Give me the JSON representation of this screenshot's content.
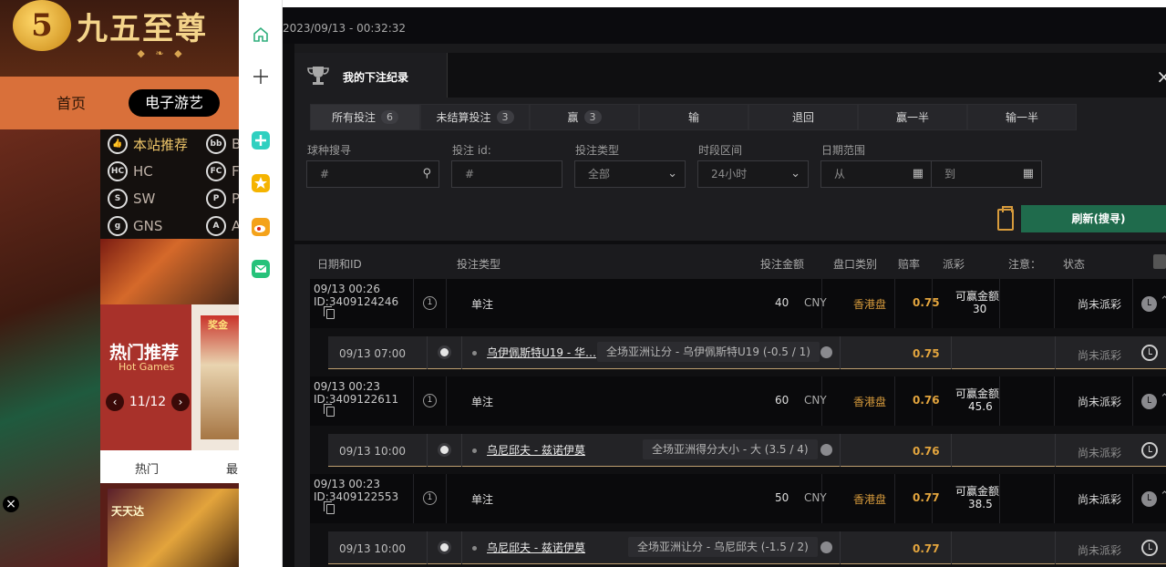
{
  "site": {
    "logo_glyph": "5",
    "logo_text": "九五至尊",
    "nav": [
      "首页",
      "电子游艺"
    ],
    "providers": [
      "本站推荐",
      "B",
      "HC",
      "F",
      "SW",
      "P",
      "GNS",
      "A"
    ],
    "hot_title": "热门推荐",
    "hot_subtitle": "Hot Games",
    "pager_label": "11/12",
    "card_tag": "奖金",
    "tabs": [
      "热门",
      "最"
    ],
    "banner2_text": "天天达"
  },
  "toolbar": {
    "items": [
      "home-icon",
      "plus-icon",
      "pin-icon",
      "star-icon",
      "weibo-icon",
      "mail-icon"
    ]
  },
  "panel": {
    "datetime": "2023/09/13 - 00:32:32"
  },
  "modal": {
    "title": "我的下注纪录",
    "tabs": [
      {
        "label": "所有投注",
        "count": "6"
      },
      {
        "label": "未结算投注",
        "count": "3"
      },
      {
        "label": "赢",
        "count": "3"
      },
      {
        "label": "输",
        "count": ""
      },
      {
        "label": "退回",
        "count": ""
      },
      {
        "label": "赢一半",
        "count": ""
      },
      {
        "label": "输一半",
        "count": ""
      }
    ],
    "filters": {
      "sport_label": "球种搜寻",
      "sport_placeholder": "#",
      "betid_label": "投注 id:",
      "betid_placeholder": "#",
      "type_label": "投注类型",
      "type_value": "全部",
      "period_label": "时段区间",
      "period_value": "24小时",
      "date_label": "日期范围",
      "date_from": "从",
      "date_to": "到"
    },
    "refresh_label": "刷新(搜寻)"
  },
  "table": {
    "headers": [
      "日期和ID",
      "投注类型",
      "投注金额",
      "盘口类别",
      "赔率",
      "派彩",
      "注意：",
      "状态"
    ],
    "rows": [
      {
        "date": "09/13 00:26",
        "id": "ID:3409124246",
        "kind": "单注",
        "amount": "40",
        "currency": "CNY",
        "market": "香港盘",
        "odds": "0.75",
        "win_label": "可赢金额",
        "win_amount": "30",
        "status": "尚未派彩",
        "sub": {
          "date": "09/13 07:00",
          "match": "乌伊佩斯特U19 - 华…",
          "bet": "全场亚洲让分 - 乌伊佩斯特U19 (-0.5 / 1)",
          "odds": "0.75",
          "status": "尚未派彩"
        }
      },
      {
        "date": "09/13 00:23",
        "id": "ID:3409122611",
        "kind": "单注",
        "amount": "60",
        "currency": "CNY",
        "market": "香港盘",
        "odds": "0.76",
        "win_label": "可赢金额",
        "win_amount": "45.6",
        "status": "尚未派彩",
        "sub": {
          "date": "09/13 10:00",
          "match": "乌尼邱夫 - 兹诺伊莫",
          "bet": "全场亚洲得分大小 - 大 (3.5 / 4)",
          "odds": "0.76",
          "status": "尚未派彩"
        }
      },
      {
        "date": "09/13 00:23",
        "id": "ID:3409122553",
        "kind": "单注",
        "amount": "50",
        "currency": "CNY",
        "market": "香港盘",
        "odds": "0.77",
        "win_label": "可赢金额",
        "win_amount": "38.5",
        "status": "尚未派彩",
        "sub": {
          "date": "09/13 10:00",
          "match": "乌尼邱夫 - 兹诺伊莫",
          "bet": "全场亚洲让分 - 乌尼邱夫 (-1.5 / 2)",
          "odds": "0.77",
          "status": "尚未派彩"
        }
      }
    ]
  }
}
